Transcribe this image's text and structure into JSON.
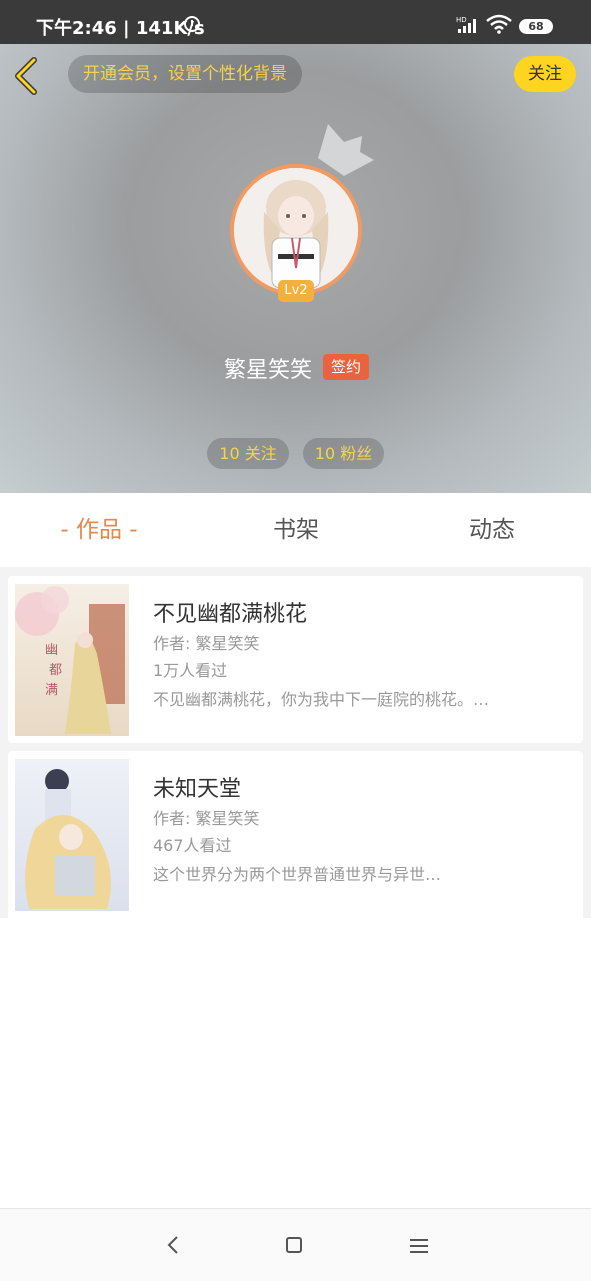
{
  "status_bar": {
    "time_speed": "下午2:46 | 141K/s",
    "battery": "68",
    "icons": [
      "alarm-icon",
      "signal-icon",
      "wifi-icon",
      "battery-icon"
    ]
  },
  "header": {
    "vip_text": "开通会员，设置个性化背景",
    "follow_label": "关注",
    "level": "Lv2",
    "username": "繁星笑笑",
    "signed_badge": "签约",
    "following": "10 关注",
    "fans": "10 粉丝"
  },
  "tabs": [
    {
      "label": "- 作品 -",
      "active": true
    },
    {
      "label": "书架",
      "active": false
    },
    {
      "label": "动态",
      "active": false
    }
  ],
  "books": [
    {
      "title": "不见幽都满桃花",
      "author": "作者: 繁星笑笑",
      "views": "1万人看过",
      "description": "不见幽都满桃花，你为我中下一庭院的桃花。…"
    },
    {
      "title": "未知天堂",
      "author": "作者: 繁星笑笑",
      "views": "467人看过",
      "description": "这个世界分为两个世界普通世界与异世…"
    }
  ],
  "colors": {
    "accent_orange": "#e8874a",
    "follow_yellow": "#fdd420",
    "signed_red": "#e9643e",
    "level_orange": "#f4b03e"
  }
}
